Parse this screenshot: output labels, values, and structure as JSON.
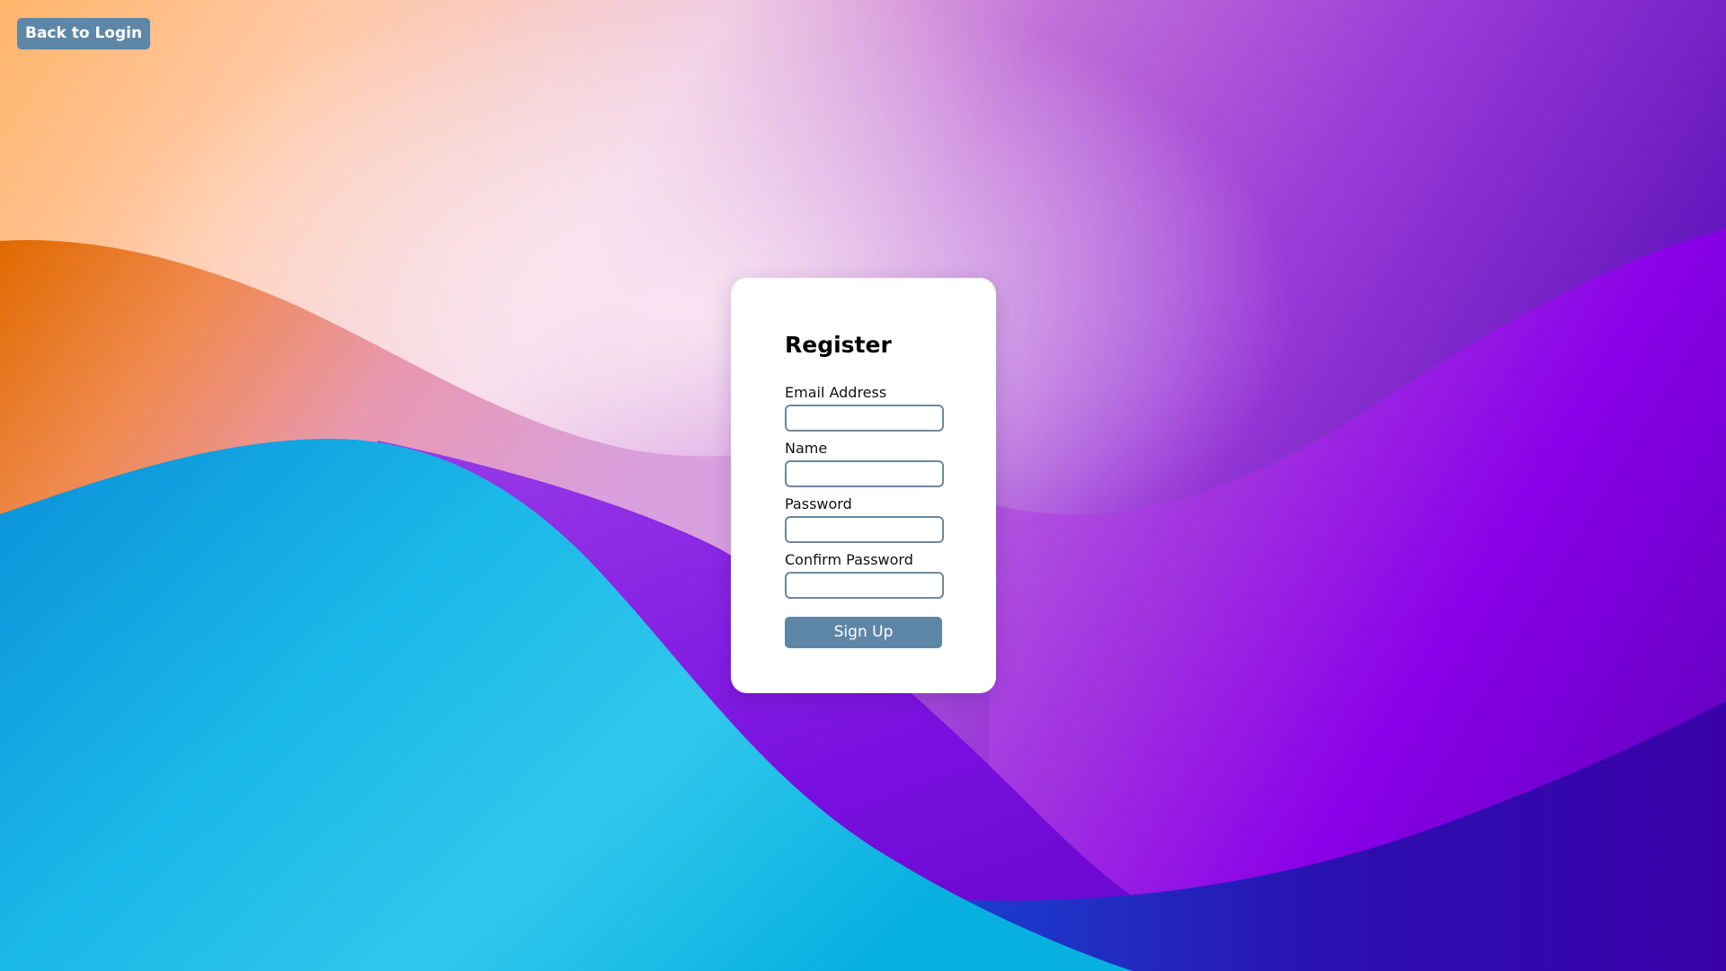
{
  "header": {
    "back_label": "Back to Login"
  },
  "form": {
    "title": "Register",
    "fields": [
      {
        "label": "Email Address",
        "value": "",
        "type": "email"
      },
      {
        "label": "Name",
        "value": "",
        "type": "text"
      },
      {
        "label": "Password",
        "value": "",
        "type": "password"
      },
      {
        "label": "Confirm Password",
        "value": "",
        "type": "password"
      }
    ],
    "submit_label": "Sign Up"
  },
  "colors": {
    "button": "#5e87a7",
    "input_border": "#6c88a0",
    "card": "#ffffff"
  },
  "background": {
    "description_icon": "abstract-wave-wallpaper"
  }
}
